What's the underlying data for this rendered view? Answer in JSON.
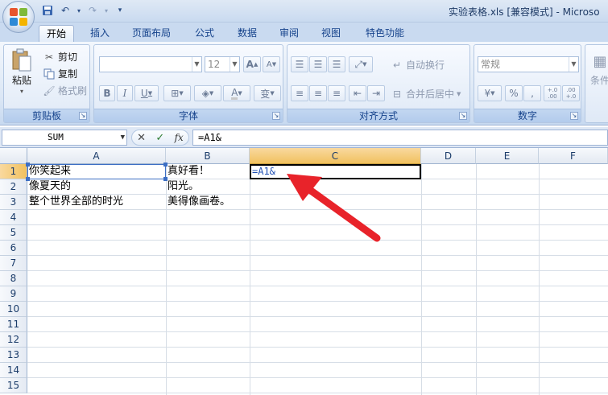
{
  "window": {
    "title": "实验表格.xls  [兼容模式] - Microso"
  },
  "quick_access": {
    "items": [
      "save-icon",
      "undo-icon",
      "redo-icon",
      "customize-icon"
    ]
  },
  "tabs": [
    {
      "label": "开始",
      "active": true
    },
    {
      "label": "插入"
    },
    {
      "label": "页面布局"
    },
    {
      "label": "公式"
    },
    {
      "label": "数据"
    },
    {
      "label": "审阅"
    },
    {
      "label": "视图"
    },
    {
      "label": "特色功能"
    }
  ],
  "ribbon": {
    "clipboard": {
      "label": "剪贴板",
      "paste": "粘贴",
      "cut": "剪切",
      "copy": "复制",
      "format_painter": "格式刷"
    },
    "font": {
      "label": "字体",
      "font_name": "",
      "font_size": "12",
      "bold": "B",
      "italic": "I",
      "underline": "U",
      "grow": "A",
      "shrink": "A",
      "font_color": "A",
      "phonetic": "变"
    },
    "alignment": {
      "label": "对齐方式",
      "wrap_text": "自动换行",
      "merge_center": "合并后居中"
    },
    "number": {
      "label": "数字",
      "format": "常规",
      "percent": "%",
      "comma": ",",
      "increase_decimal": "+.0 .00",
      "decrease_decimal": ".00 +.0"
    },
    "styles": {
      "label": "条件"
    }
  },
  "formula_bar": {
    "name_box": "SUM",
    "cancel": "✕",
    "enter": "✓",
    "fx": "fx",
    "formula": "=A1&"
  },
  "sheet": {
    "columns": [
      "A",
      "B",
      "C",
      "D",
      "E",
      "F"
    ],
    "rows": [
      "1",
      "2",
      "3",
      "4",
      "5",
      "6",
      "7",
      "8",
      "9",
      "10",
      "11",
      "12",
      "13",
      "14",
      "15"
    ],
    "cells": {
      "A1": "你笑起来",
      "A2": "像夏天的",
      "A3": "整个世界全部的时光",
      "B1": "真好看！",
      "B2": "阳光。",
      "B3": "美得像画卷。",
      "C1": "=A1&"
    },
    "active_column": "C",
    "active_row": "1"
  },
  "colors": {
    "accent": "#15428b",
    "reference_border": "#3d6fc4",
    "arrow": "#e8232a"
  }
}
